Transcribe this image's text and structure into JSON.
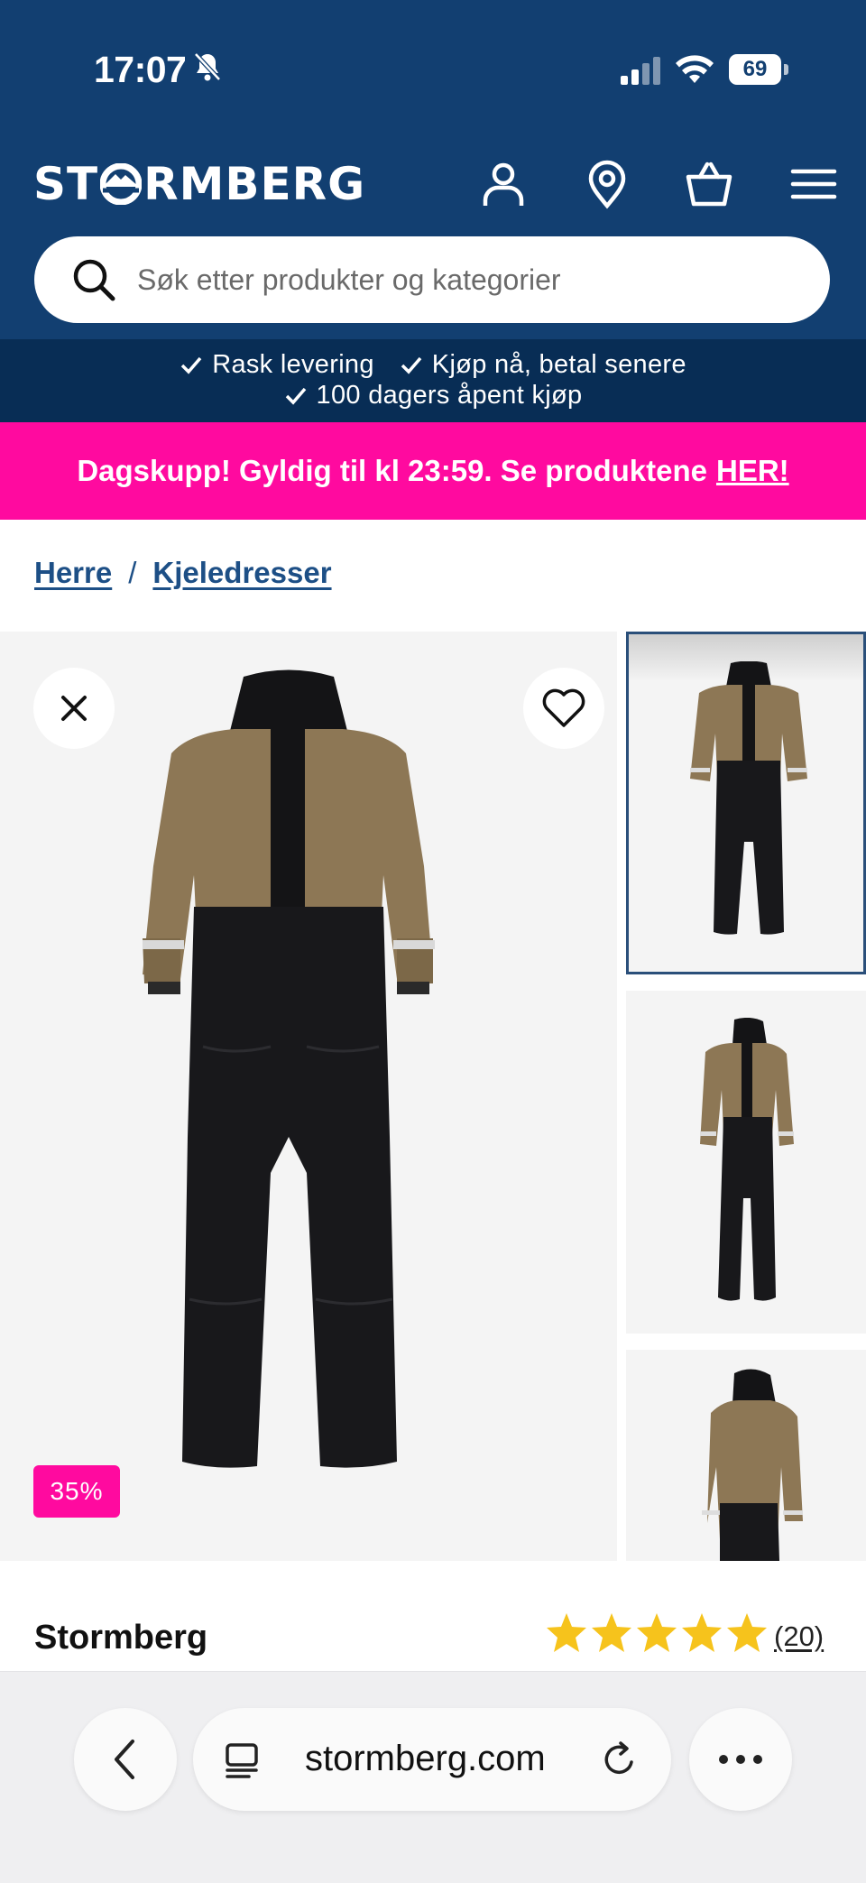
{
  "status_bar": {
    "time": "17:07",
    "battery": "69",
    "icons": [
      "bell-slash-icon",
      "signal-icon",
      "wifi-icon",
      "battery-icon"
    ]
  },
  "header": {
    "logo_left": "ST",
    "logo_right": "RMBERG",
    "icons": [
      "user-icon",
      "location-icon",
      "bag-icon",
      "menu-icon"
    ],
    "background": "#123f71"
  },
  "search": {
    "placeholder": "Søk etter produkter og kategorier"
  },
  "usp": {
    "items": [
      "Rask levering",
      "Kjøp nå, betal senere",
      "100 dagers åpent kjøp"
    ]
  },
  "promo": {
    "text": "Dagskupp! Gyldig til kl 23:59. Se produktene",
    "link": "HER!",
    "background": "#ff0a9f"
  },
  "breadcrumb": {
    "items": [
      "Herre",
      "Kjeledresser"
    ],
    "separator": "/"
  },
  "gallery": {
    "discount": "35%",
    "thumbnails": 3,
    "selected_thumbnail": 1
  },
  "product": {
    "brand": "Stormberg",
    "rating": 5,
    "review_count": "(20)"
  },
  "browser": {
    "url": "stormberg.com"
  }
}
